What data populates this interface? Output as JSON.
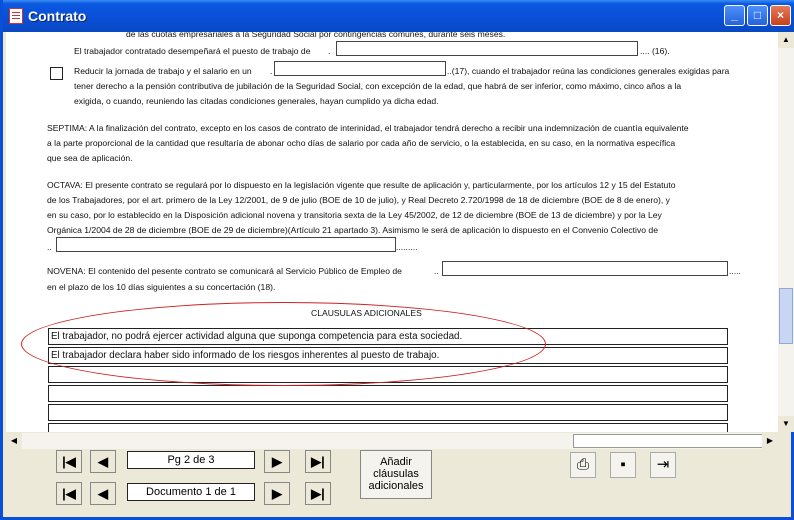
{
  "window": {
    "title": "Contrato"
  },
  "document": {
    "cut_line": "de las cuotas empresariales a la Seguridad Social por contingencias comunes, durante seis meses.",
    "puesto_prefix": "El trabajador contratado desempeñará el puesto de trabajo de",
    "puesto_suffix": "....   (16).",
    "reducir_l1a": "Reducir la jornada de trabajo y el salario en un",
    "reducir_l1b": "..(17), cuando el trabajador reúna las condiciones generales exigidas para",
    "reducir_l2": "tener derecho a la pensión contributiva de jubilación de la Seguridad Social, con excepción de la edad, que habrá de ser inferior, como máximo, cinco años a la",
    "reducir_l3": "exigida, o cuando, reuniendo las citadas condiciones generales, hayan cumplido ya dicha edad.",
    "septima_l1": "SEPTIMA: A la finalización del contrato, excepto en los casos de contrato de interinidad, el trabajador tendrá derecho a recibir una indemnización de cuantía equivalente",
    "septima_l2": "a la parte proporcional de la cantidad que resultaría de abonar ocho días de salario por cada año de servicio, o la establecida, en su caso, en la normativa específica",
    "septima_l3": "que sea de aplicación.",
    "octava_l1": "OCTAVA: El presente contrato se regulará por lo dispuesto en la legislación vigente que resulte de aplicación y, particularmente, por los artículos 12 y 15 del Estatuto",
    "octava_l2": "de los Trabajadores, por el art. primero de la Ley 12/2001, de 9 de julio (BOE de 10 de julio), y  Real Decreto 2.720/1998 de 18 de diciembre (BOE de 8 de enero), y",
    "octava_l3": "en su caso, por lo establecido en la Disposición adicional novena y transitoria sexta de la Ley 45/2002, de 12 de diciembre (BOE de 13 de diciembre) y por la Ley",
    "octava_l4": "Orgánica 1/2004 de 28 de diciembre (BOE de 29 de diciembre)(Artículo 21 apartado 3). Asimismo le será de aplicación lo dispuesto en el Convenio Colectivo de",
    "octava_l5a": "..",
    "octava_l5b": ".........",
    "novena_l1a": "NOVENA: El contenido del pesente contrato se comunicará al Servicio Público de Empleo de",
    "novena_l1b": ".....",
    "novena_l2": "en el plazo de los 10 días siguientes a su concertación (18).",
    "clausulas_title": "CLAUSULAS ADICIONALES",
    "clausulas": [
      "El trabajador, no podrá ejercer actividad alguna que suponga competencia para esta sociedad.",
      "El trabajador declara haber sido informado de los riesgos inherentes al puesto de trabajo.",
      "",
      "",
      "",
      ""
    ]
  },
  "nav": {
    "page_label": "Pg 2 de 3",
    "doc_label": "Documento 1 de 1",
    "first_glyph": "|◀",
    "prev_glyph": "◀",
    "next_glyph": "▶",
    "last_glyph": "▶|"
  },
  "add_button": {
    "label_l1": "Añadir",
    "label_l2": "cláusulas",
    "label_l3": "adicionales"
  },
  "tools": {
    "print_glyph": "⎙",
    "save_glyph": "▪",
    "exit_glyph": "⇥"
  },
  "window_buttons": {
    "minimize": "_",
    "maximize": "□",
    "close": "×"
  },
  "colors": {
    "titlebar": "#0a4fd8",
    "annotation": "#cc2222"
  }
}
